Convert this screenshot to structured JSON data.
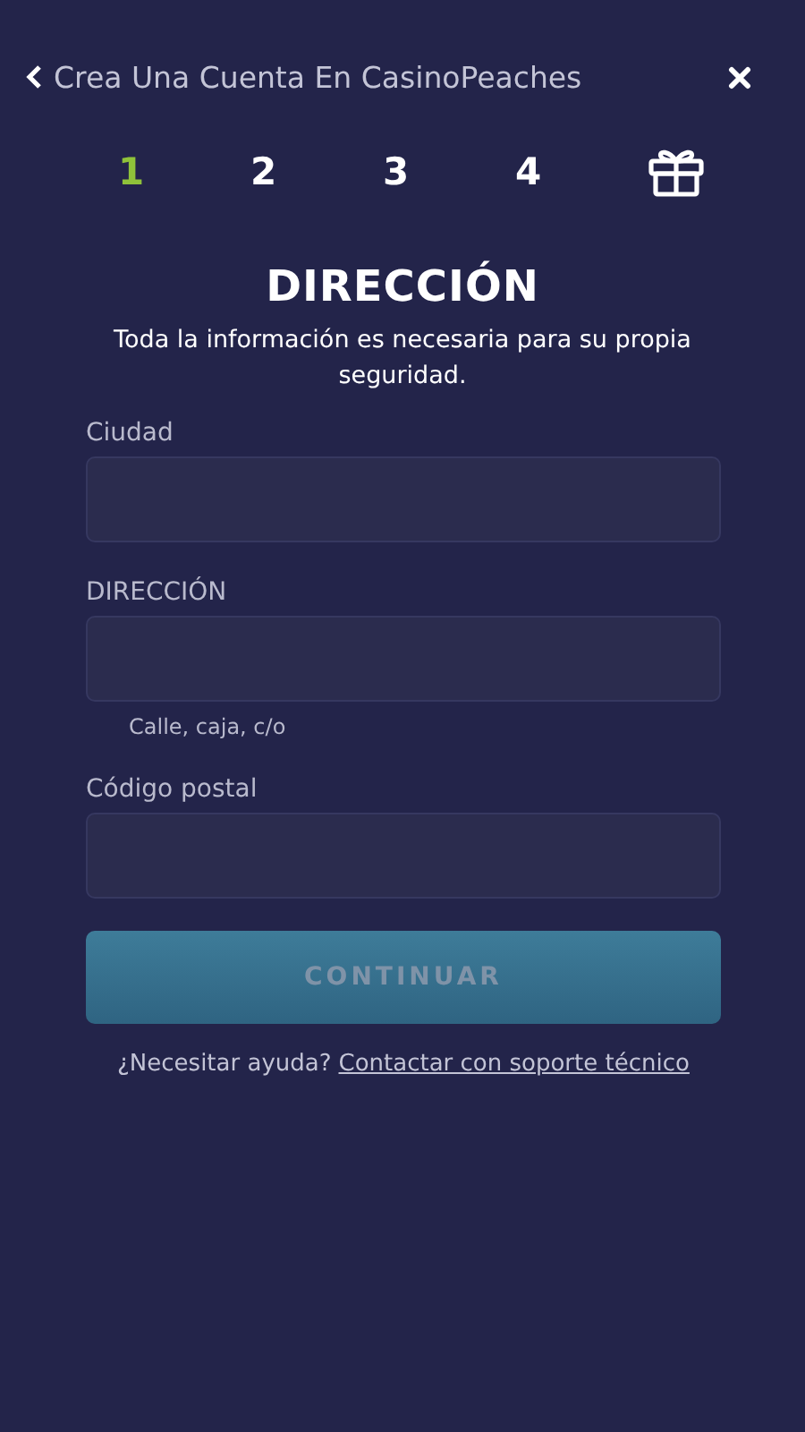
{
  "header": {
    "title": "Crea Una Cuenta En CasinoPeaches"
  },
  "steps": [
    {
      "kind": "number",
      "label": "1",
      "selected": true
    },
    {
      "kind": "number",
      "label": "2",
      "selected": false
    },
    {
      "kind": "number",
      "label": "3",
      "selected": false
    },
    {
      "kind": "number",
      "label": "4",
      "selected": false
    },
    {
      "kind": "gift",
      "selected": false
    }
  ],
  "heading": "DIRECCIÓN",
  "subtitle": "Toda la información es necesaria para su propia seguridad.",
  "fields": [
    {
      "label": "Ciudad"
    },
    {
      "label": "DIRECCIÓN",
      "hint": "Calle, caja, c/o"
    },
    {
      "label": "Código postal"
    }
  ],
  "submit": {
    "label": "CONTINUAR",
    "disabled": true
  },
  "help": {
    "text": "¿Necesitar ayuda?",
    "link": "Contactar con soporte técnico"
  }
}
